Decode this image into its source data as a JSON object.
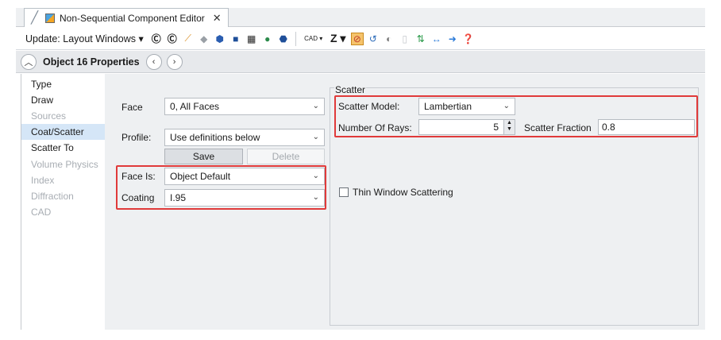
{
  "tab": {
    "title": "Non-Sequential Component Editor",
    "close": "✕"
  },
  "toolbar": {
    "update_label": "Update: Layout Windows ▾",
    "cad_label": "CAD ▾",
    "z_label": "Z ▾"
  },
  "header": {
    "title": "Object  16 Properties"
  },
  "nav": {
    "items": [
      {
        "label": "Type"
      },
      {
        "label": "Draw"
      },
      {
        "label": "Sources"
      },
      {
        "label": "Coat/Scatter"
      },
      {
        "label": "Scatter To"
      },
      {
        "label": "Volume Physics"
      },
      {
        "label": "Index"
      },
      {
        "label": "Diffraction"
      },
      {
        "label": "CAD"
      }
    ]
  },
  "form": {
    "face_label": "Face",
    "face_value": "0, All Faces",
    "profile_label": "Profile:",
    "profile_value": "Use definitions below",
    "save_label": "Save",
    "delete_label": "Delete",
    "face_is_label": "Face Is:",
    "face_is_value": "Object Default",
    "coating_label": "Coating",
    "coating_value": "I.95"
  },
  "scatter": {
    "group_label": "Scatter",
    "model_label": "Scatter Model:",
    "model_value": "Lambertian",
    "rays_label": "Number Of Rays:",
    "rays_value": "5",
    "fraction_label": "Scatter Fraction",
    "fraction_value": "0.8",
    "thin_window_label": "Thin Window Scattering"
  },
  "colors": {
    "highlight": "#e03a3a",
    "selected_nav": "#d5e6f7",
    "panel": "#eef0f2"
  }
}
